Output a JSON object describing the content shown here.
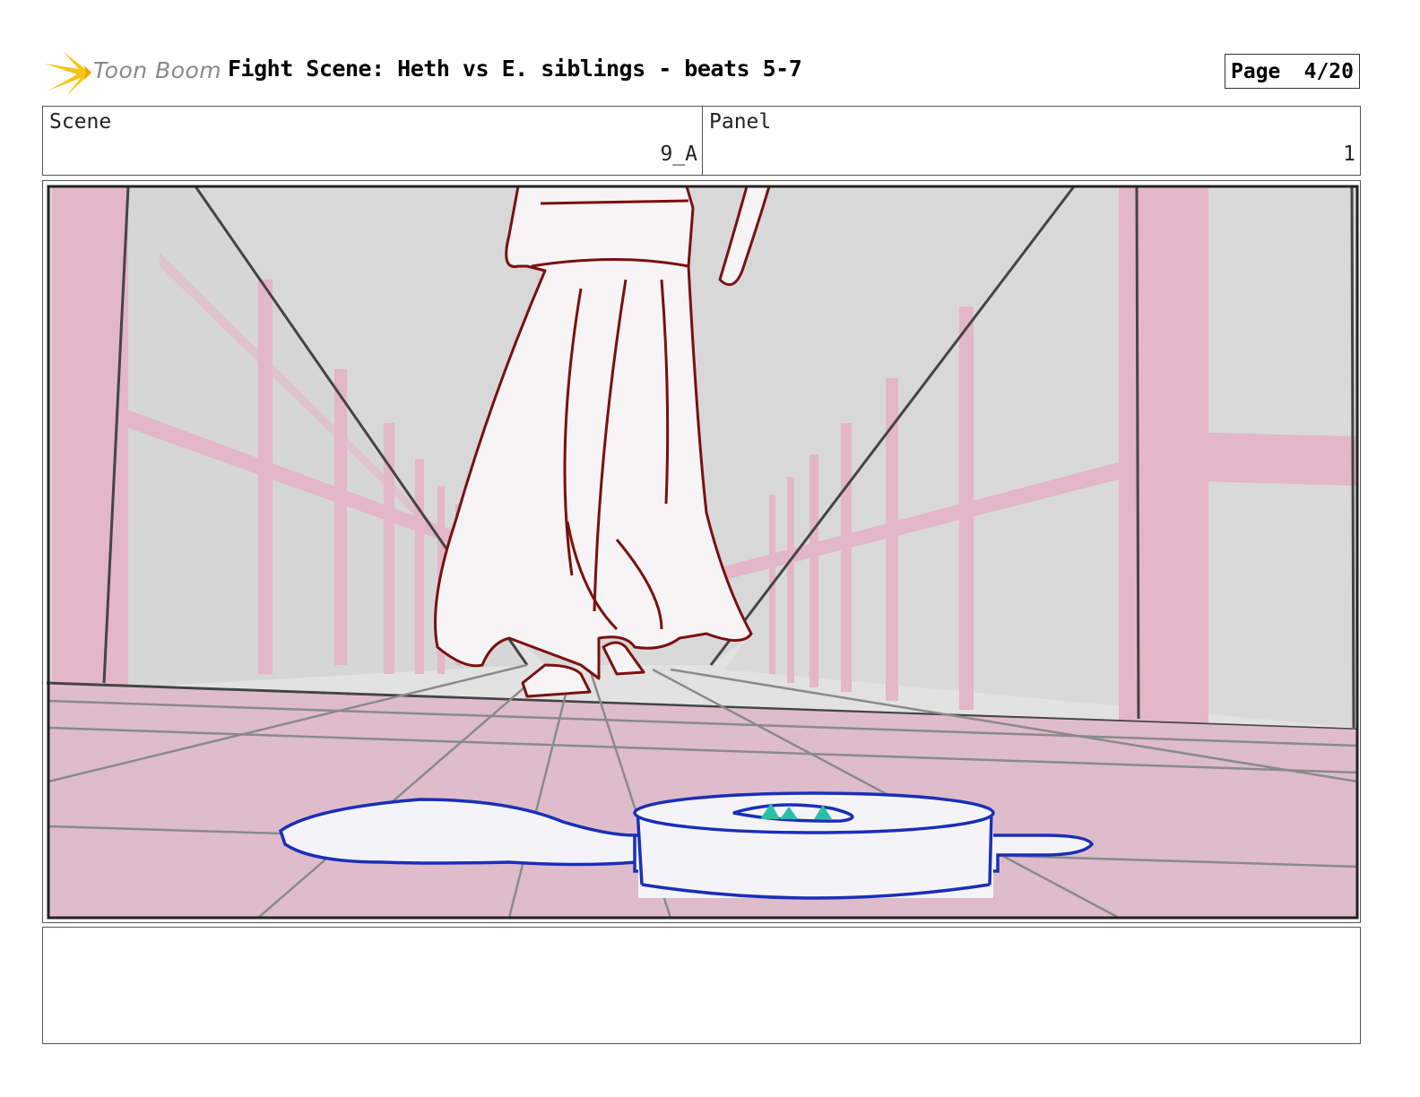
{
  "header": {
    "logo_text": "Toon Boom",
    "title": "Fight Scene: Heth vs E. siblings - beats 5-7",
    "page_label": "Page",
    "page_value": "4/20"
  },
  "info": {
    "scene_label": "Scene",
    "scene_value": "9_A",
    "panel_label": "Panel",
    "panel_value": "1"
  },
  "notes": {
    "text": ""
  },
  "colors": {
    "logo_star": "#f5c518",
    "railing_pink": "#e3b6c8",
    "floor_pink": "#dfbccb",
    "wall_gray": "#dcdcdc",
    "robe_outline": "#7a1010",
    "device_outline": "#1a2fb8",
    "device_accent": "#2bbfa8"
  }
}
